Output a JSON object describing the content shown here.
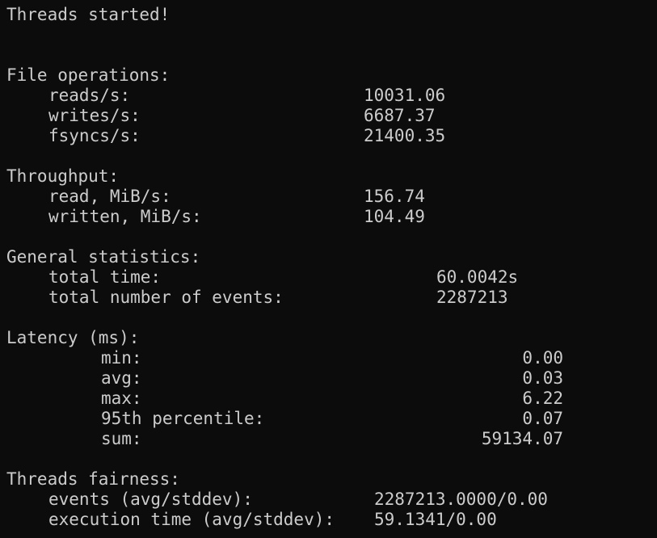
{
  "threads_started": "Threads started!",
  "file_ops": {
    "header": "File operations:",
    "rows": [
      {
        "label": "reads/s:",
        "value": "10031.06"
      },
      {
        "label": "writes/s:",
        "value": "6687.37"
      },
      {
        "label": "fsyncs/s:",
        "value": "21400.35"
      }
    ]
  },
  "throughput": {
    "header": "Throughput:",
    "rows": [
      {
        "label": "read, MiB/s:",
        "value": "156.74"
      },
      {
        "label": "written, MiB/s:",
        "value": "104.49"
      }
    ]
  },
  "general": {
    "header": "General statistics:",
    "rows": [
      {
        "label": "total time:",
        "value": "60.0042s"
      },
      {
        "label": "total number of events:",
        "value": "2287213"
      }
    ]
  },
  "latency": {
    "header": "Latency (ms):",
    "rows": [
      {
        "label": "min:",
        "value": "0.00"
      },
      {
        "label": "avg:",
        "value": "0.03"
      },
      {
        "label": "max:",
        "value": "6.22"
      },
      {
        "label": "95th percentile:",
        "value": "0.07"
      },
      {
        "label": "sum:",
        "value": "59134.07"
      }
    ]
  },
  "fairness": {
    "header": "Threads fairness:",
    "rows": [
      {
        "label": "events (avg/stddev):",
        "value": "2287213.0000/0.00"
      },
      {
        "label": "execution time (avg/stddev):",
        "value": "59.1341/0.00"
      }
    ]
  }
}
